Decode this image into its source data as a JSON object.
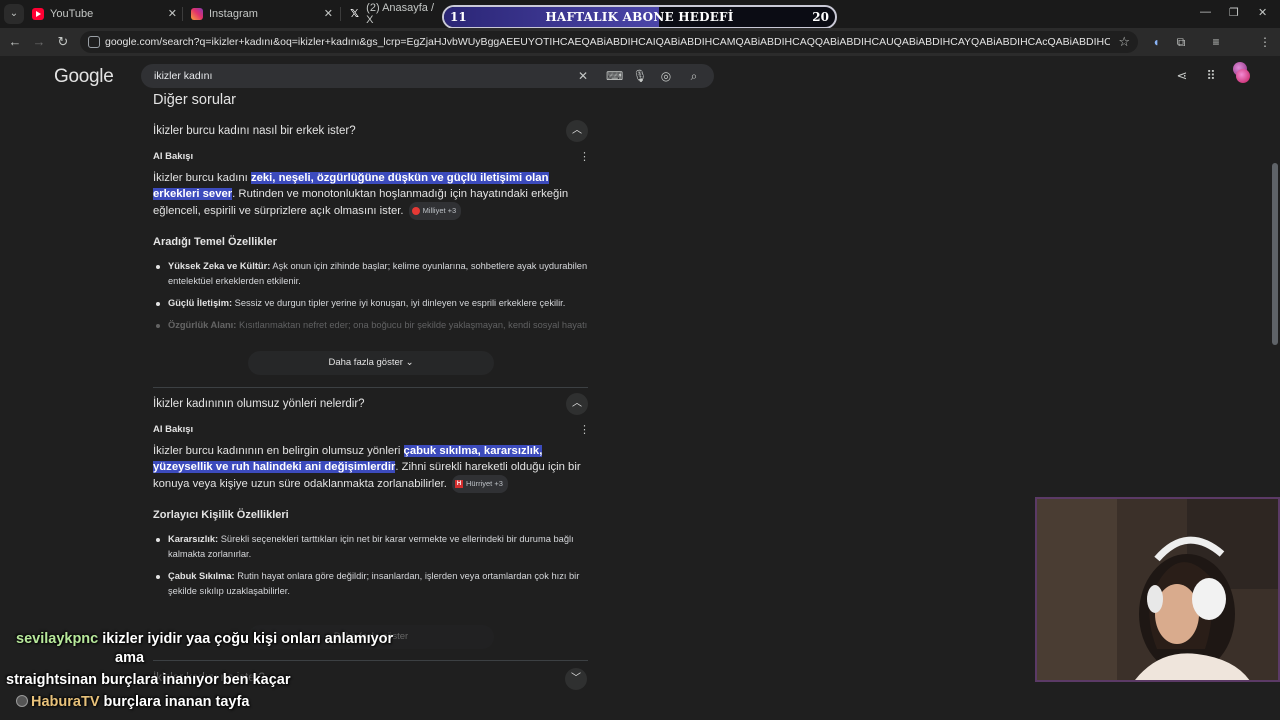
{
  "tabs": [
    {
      "title": "YouTube",
      "icon": "youtube-icon"
    },
    {
      "title": "Instagram",
      "icon": "instagram-icon"
    },
    {
      "title": "(2) Anasayfa / X",
      "icon": "x-icon"
    }
  ],
  "goal_banner": {
    "current": "11",
    "title": "HAFTALIK ABONE HEDEFİ",
    "target": "20",
    "progress_fraction": 0.55
  },
  "address_bar": {
    "url": "google.com/search?q=ikizler+kadını&oq=ikizler+kadını&gs_lcrp=EgZjaHJvbWUyBggAEEUYOTIHCAEQABiABDIHCAIQABiABDIHCAMQABiABDIHCAQQABiABDIHCAUQABiABDIHCAYQABiABDIHCAcQABiABDIHCAgQABiABDIHCAkQABiABNIBCDE..."
  },
  "google": {
    "logo": "Google",
    "query": "ikizler kadını"
  },
  "section_title": "Diğer sorular",
  "questions": [
    {
      "question": "İkizler burcu kadını nasıl bir erkek ister?",
      "ai_label": "AI Bakışı",
      "answer_pre": "İkizler burcu kadını ",
      "answer_highlight": "zeki, neşeli, özgürlüğüne düşkün ve güçlü iletişimi olan erkekleri sever",
      "answer_post": ". Rutinden ve monotonluktan hoşlanmadığı için hayatındaki erkeğin eğlenceli, espirili ve sürprizlere açık olmasını ister.",
      "source": "Milliyet +3",
      "subheading": "Aradığı Temel Özellikler",
      "bullets": [
        {
          "title": "Yüksek Zeka ve Kültür:",
          "text": " Aşk onun için zihinde başlar; kelime oyunlarına, sohbetlere ayak uydurabilen entelektüel erkeklerden etkilenir."
        },
        {
          "title": "Güçlü İletişim:",
          "text": " Sessiz ve durgun tipler yerine iyi konuşan, iyi dinleyen ve esprili erkeklere çekilir."
        },
        {
          "title": "Özgürlük Alanı:",
          "text": " Kısıtlanmaktan nefret eder; ona boğucu bir şekilde yaklaşmayan, kendi sosyal hayatı olan biri..."
        }
      ],
      "more_label": "Daha fazla göster"
    },
    {
      "question": "İkizler kadınının olumsuz yönleri nelerdir?",
      "ai_label": "AI Bakışı",
      "answer_pre": "İkizler burcu kadınının en belirgin olumsuz yönleri ",
      "answer_highlight": "çabuk sıkılma, kararsızlık, yüzeysellik ve ruh halindeki ani değişimlerdir",
      "answer_post": ". Zihni sürekli hareketli olduğu için bir konuya veya kişiye uzun süre odaklanmakta zorlanabilirler.",
      "source": "Hürriyet +3",
      "subheading": "Zorlayıcı Kişilik Özellikleri",
      "bullets": [
        {
          "title": "Kararsızlık:",
          "text": " Sürekli seçenekleri tarttıkları için net bir karar vermekte ve ellerindeki bir duruma bağlı kalmakta zorlanırlar."
        },
        {
          "title": "Çabuk Sıkılma:",
          "text": " Rutin hayat onlara göre değildir; insanlardan, işlerden veya ortamlardan çok hızı bir şekilde sıkılıp uzaklaşabilirler."
        }
      ],
      "more_label": "Daha fazla göster"
    }
  ],
  "third_question": "İkizler kadını ne ister?",
  "chat": [
    {
      "user": "sevilaykpnc",
      "message": "ikizler iyidir yaa çoğu kişi onları anlamıyor",
      "continuation": "ama"
    },
    {
      "user": "straightsinan",
      "message": "burçlara inanıyor ben kaçar"
    },
    {
      "user": "HaburaTV",
      "message": "burçlara inanan tayfa"
    }
  ]
}
